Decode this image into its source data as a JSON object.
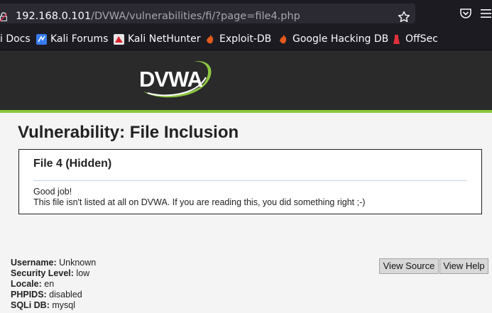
{
  "browser": {
    "url_host": "192.168.0.101",
    "url_path": "/DVWA/vulnerabilities/fi/?page=file4.php",
    "bookmarks": [
      {
        "label": "i Docs",
        "icon": "kali-docs-icon"
      },
      {
        "label": "Kali Forums",
        "icon": "kali-forums-icon"
      },
      {
        "label": "Kali NetHunter",
        "icon": "kali-nethunter-icon"
      },
      {
        "label": "Exploit-DB",
        "icon": "exploit-db-icon"
      },
      {
        "label": "Google Hacking DB",
        "icon": "exploit-db-icon"
      },
      {
        "label": "OffSec",
        "icon": "offsec-icon"
      }
    ]
  },
  "header": {
    "logo_text": "DVWA"
  },
  "page": {
    "title": "Vulnerability: File Inclusion",
    "box_title": "File 4 (Hidden)",
    "line1": "Good job!",
    "line2": "This file isn't listed at all on DVWA. If you are reading this, you did something right ;-)"
  },
  "footer": {
    "username_label": "Username:",
    "username_value": " Unknown",
    "security_label": "Security Level:",
    "security_value": " low",
    "locale_label": "Locale:",
    "locale_value": " en",
    "phpids_label": "PHPIDS:",
    "phpids_value": " disabled",
    "sqli_label": "SQLi DB:",
    "sqli_value": " mysql",
    "view_source": "View Source",
    "view_help": "View Help"
  },
  "colors": {
    "accent_green": "#8dc63f",
    "header_bg": "#2a2a2a",
    "browser_bg": "#1c1b22"
  }
}
